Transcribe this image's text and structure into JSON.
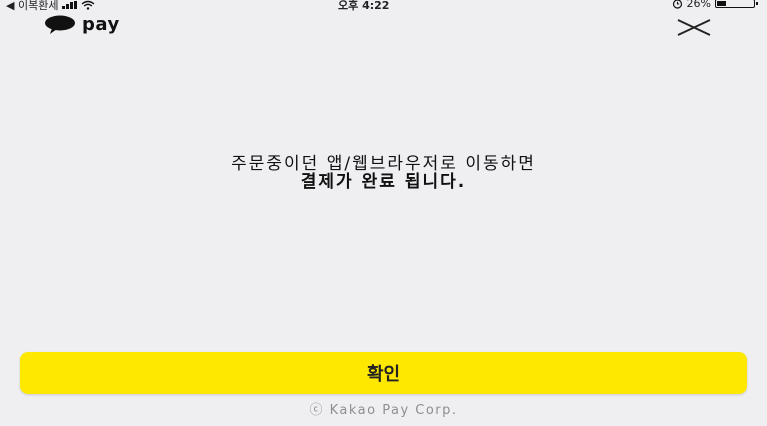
{
  "status_bar": {
    "carrier": "◀ 이복환세",
    "time": "오후 4:22",
    "battery_percent": "26%",
    "battery_level": 0.26
  },
  "header": {
    "brand": "pay",
    "close_icon": "close-icon",
    "brand_icon": "kakao-speech-bubble-icon"
  },
  "message": {
    "line1": "주문중이던 앱/웹브라우저로 이동하면",
    "line2": "결제가 완료 됩니다."
  },
  "confirm_label": "확인",
  "footer": "ⓒ Kakao Pay Corp.",
  "colors": {
    "accent": "#ffe800",
    "background": "#efeff2"
  }
}
